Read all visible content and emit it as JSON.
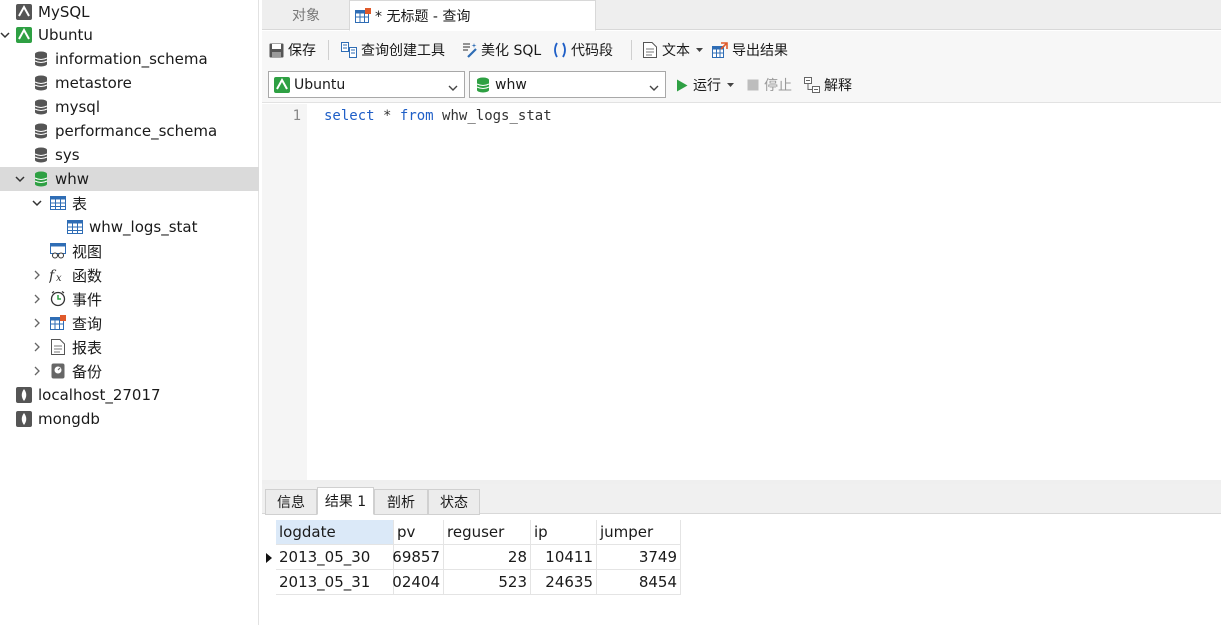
{
  "sidebar": {
    "connections": [
      {
        "label": "MySQL",
        "icon": "mysql-connection-icon"
      },
      {
        "label": "Ubuntu",
        "icon": "mysql-connection-icon"
      }
    ],
    "databases": [
      "information_schema",
      "metastore",
      "mysql",
      "performance_schema",
      "sys",
      "whw"
    ],
    "whw_children": {
      "tables_label": "表",
      "table_item": "whw_logs_stat",
      "views_label": "视图",
      "functions_label": "函数",
      "events_label": "事件",
      "queries_label": "查询",
      "reports_label": "报表",
      "backups_label": "备份"
    },
    "other_connections": [
      {
        "label": "localhost_27017",
        "icon": "mongodb-connection-icon"
      },
      {
        "label": "mongdb",
        "icon": "mongodb-connection-icon"
      }
    ]
  },
  "tabs": {
    "objects": "对象",
    "query": "* 无标题 - 查询"
  },
  "toolbar": {
    "save": "保存",
    "query_builder": "查询创建工具",
    "beautify": "美化 SQL",
    "snippet": "代码段",
    "text": "文本",
    "export": "导出结果"
  },
  "selectors": {
    "connection": "Ubuntu",
    "database": "whw",
    "run": "运行",
    "stop": "停止",
    "explain": "解释"
  },
  "editor": {
    "line_number": "1",
    "kw_select": "select",
    "star": "*",
    "kw_from": "from",
    "table": "whw_logs_stat"
  },
  "result_tabs": [
    "信息",
    "结果 1",
    "剖析",
    "状态"
  ],
  "result_grid": {
    "columns": [
      "logdate",
      "pv",
      "reguser",
      "ip",
      "jumper"
    ],
    "rows": [
      [
        "2013_05_30",
        "69857",
        "28",
        "10411",
        "3749"
      ],
      [
        "2013_05_31",
        "02404",
        "523",
        "24635",
        "8454"
      ]
    ]
  },
  "colors": {
    "accent_green": "#2ea043",
    "keyword_blue": "#1f5fc7",
    "selection_gray": "#dadada",
    "header_sorted_blue": "#dbe9f8"
  }
}
